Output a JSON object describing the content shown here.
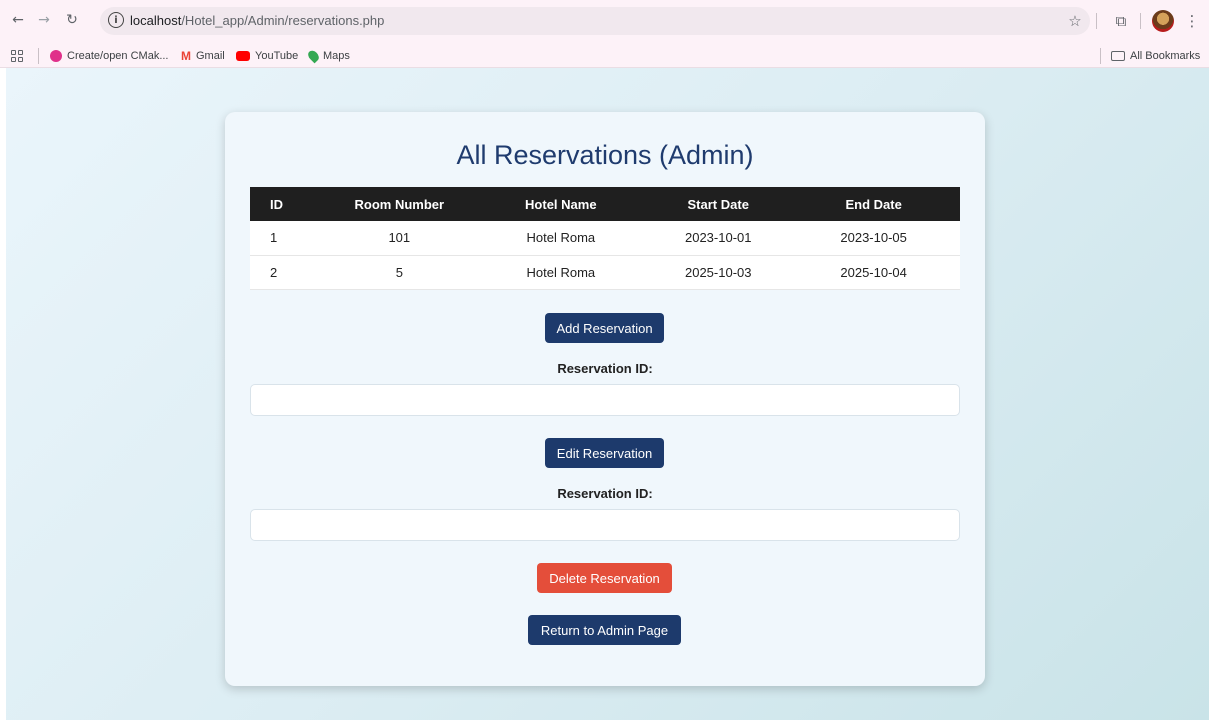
{
  "browser": {
    "url_host": "localhost",
    "url_path": "/Hotel_app/Admin/reservations.php",
    "back_icon": "←",
    "forward_icon": "→",
    "reload_icon": "↻",
    "info_icon": "i",
    "star_icon": "☆",
    "extensions_icon": "⧉",
    "menu_icon": "⋮"
  },
  "bookmarks": {
    "items": [
      {
        "label": "Create/open CMak...",
        "color": "#e0308a"
      },
      {
        "label": "Gmail",
        "icon": "M",
        "color": "#ea4335"
      },
      {
        "label": "YouTube",
        "color": "#ff0000"
      },
      {
        "label": "Maps",
        "color": "#34a853"
      }
    ],
    "all_bookmarks": "All Bookmarks"
  },
  "page": {
    "title": "All Reservations (Admin)",
    "table": {
      "headers": [
        "ID",
        "Room Number",
        "Hotel Name",
        "Start Date",
        "End Date"
      ],
      "rows": [
        [
          "1",
          "101",
          "Hotel Roma",
          "2023-10-01",
          "2023-10-05"
        ],
        [
          "2",
          "5",
          "Hotel Roma",
          "2025-10-03",
          "2025-10-04"
        ]
      ]
    },
    "add_button": "Add Reservation",
    "edit_label": "Reservation ID:",
    "edit_value": "",
    "edit_button": "Edit Reservation",
    "delete_label": "Reservation ID:",
    "delete_value": "",
    "delete_button": "Delete Reservation",
    "return_button": "Return to Admin Page"
  },
  "colors": {
    "primary": "#1d3a6c",
    "danger": "#e44e3a",
    "title": "#1f3b6e",
    "table_header": "#1f1f1f"
  }
}
